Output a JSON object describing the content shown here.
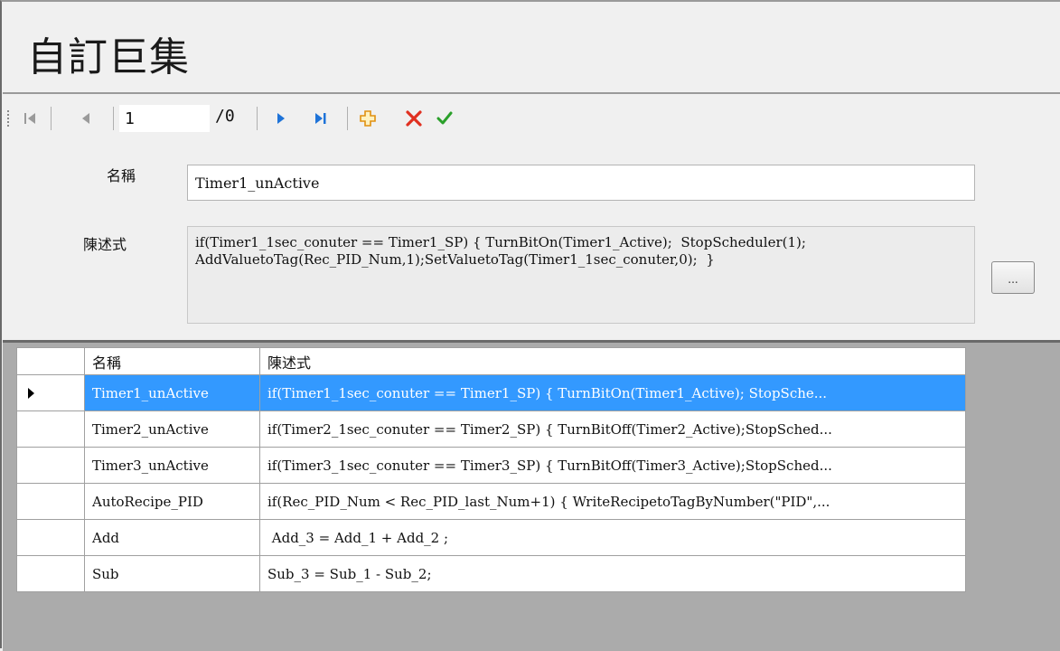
{
  "page_title": "自訂巨集",
  "navigator": {
    "first_icon": "move-first-icon",
    "prev_icon": "move-previous-icon",
    "position": "1",
    "count": "/0",
    "next_icon": "move-next-icon",
    "last_icon": "move-last-icon",
    "add_icon": "add-new-icon",
    "delete_icon": "delete-icon",
    "save_icon": "save-checkmark-icon",
    "colors": {
      "nav_blue": "#1e73d8",
      "add_orange": "#f0a020",
      "delete_red": "#e03020",
      "save_green": "#2aa02a"
    }
  },
  "form": {
    "name_label": "名稱",
    "name_value": "Timer1_unActive",
    "statement_label": "陳述式",
    "statement_value": "if(Timer1_1sec_conuter == Timer1_SP) { TurnBitOn(Timer1_Active);  StopScheduler(1);\nAddValuetoTag(Rec_PID_Num,1);SetValuetoTag(Timer1_1sec_conuter,0);  }",
    "browse_button": "..."
  },
  "grid": {
    "columns": [
      "名稱",
      "陳述式"
    ],
    "selection_color": "#3399ff",
    "rows": [
      {
        "name": "Timer1_unActive",
        "statement": "if(Timer1_1sec_conuter == Timer1_SP) { TurnBitOn(Timer1_Active);  StopSche...",
        "selected": true
      },
      {
        "name": "Timer2_unActive",
        "statement": "if(Timer2_1sec_conuter == Timer2_SP) { TurnBitOff(Timer2_Active);StopSched...",
        "selected": false
      },
      {
        "name": "Timer3_unActive",
        "statement": "if(Timer3_1sec_conuter == Timer3_SP) { TurnBitOff(Timer3_Active);StopSched...",
        "selected": false
      },
      {
        "name": "AutoRecipe_PID",
        "statement": "if(Rec_PID_Num < Rec_PID_last_Num+1) { WriteRecipetoTagByNumber(\"PID\",...",
        "selected": false
      },
      {
        "name": "Add",
        "statement": " Add_3 = Add_1 + Add_2 ;",
        "selected": false
      },
      {
        "name": "Sub",
        "statement": "Sub_3 = Sub_1 - Sub_2;",
        "selected": false
      }
    ]
  }
}
